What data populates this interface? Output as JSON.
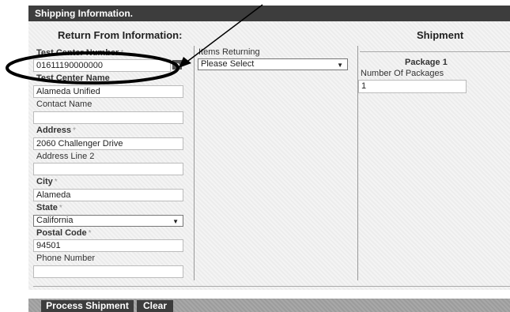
{
  "window": {
    "title": "Shipping Information."
  },
  "return_from": {
    "heading": "Return From Information:",
    "fields": [
      {
        "label": "Test Center Number",
        "value": "01611190000000",
        "required": true
      },
      {
        "label": "Test Center Name",
        "value": "Alameda Unified",
        "required": false
      },
      {
        "label": "Contact Name",
        "value": "",
        "required": false
      },
      {
        "label": "Address",
        "value": "2060 Challenger Drive",
        "required": true
      },
      {
        "label": "Address Line 2",
        "value": "",
        "required": false
      },
      {
        "label": "City",
        "value": "Alameda",
        "required": true
      },
      {
        "label": "State",
        "value": "California",
        "required": true
      },
      {
        "label": "Postal Code",
        "value": "94501",
        "required": true
      },
      {
        "label": "Phone Number",
        "value": "",
        "required": false
      }
    ],
    "required_mark": "*"
  },
  "items": {
    "label": "Items Returning",
    "selected": "Please Select"
  },
  "shipment": {
    "heading": "Shipment",
    "package_title": "Package 1",
    "packages_label": "Number Of Packages",
    "packages_value": "1"
  },
  "actions": {
    "process_label": "Process Shipment",
    "clear_label": "Clear"
  },
  "icons": {
    "go": "arrow-right-icon",
    "dropdown": "chevron-down-icon"
  },
  "colors": {
    "titlebar": "#3d3d3d",
    "button": "#3d3d3d",
    "annotation": "#000000"
  }
}
